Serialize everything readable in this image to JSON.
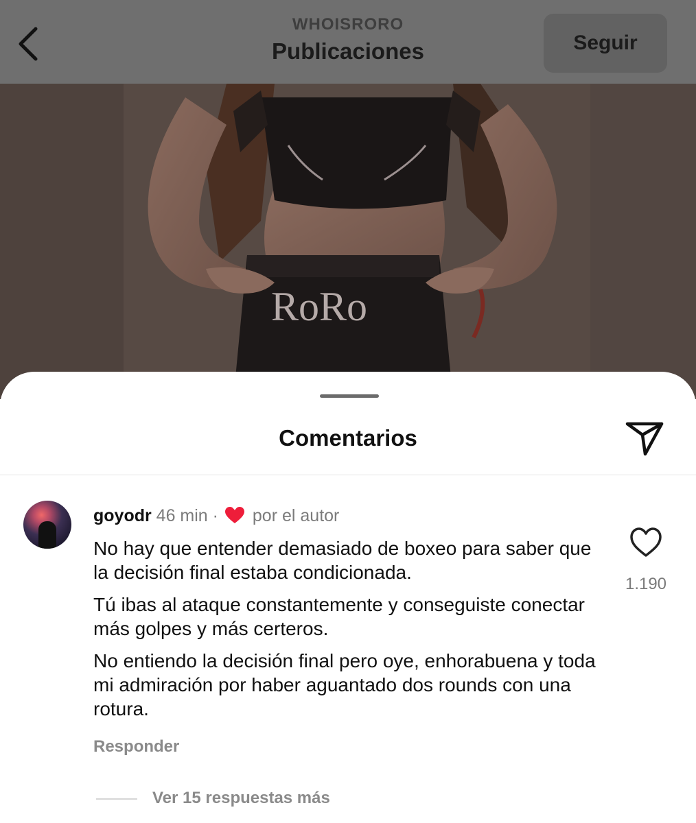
{
  "header": {
    "subtitle": "WHOISRORO",
    "title": "Publicaciones",
    "follow_label": "Seguir",
    "back_icon": "chevron-left-icon"
  },
  "post": {
    "shorts_text": "RoRo"
  },
  "comments_sheet": {
    "title": "Comentarios",
    "share_icon": "paper-plane-icon",
    "comment": {
      "username": "goyodr",
      "time": "46 min",
      "separator": "·",
      "liked_by_author_label": "por el autor",
      "paragraphs": [
        "No hay que entender demasiado de boxeo para saber que la decisión final estaba condicionada.",
        "Tú ibas al ataque constantemente y conseguiste conectar más golpes y más certeros.",
        "No entiendo la decisión final pero oye, enhorabuena y toda mi admiración por haber aguantado dos rounds con una rotura."
      ],
      "like_count": "1.190",
      "reply_label": "Responder",
      "view_replies_label": "Ver 15 respuestas más"
    }
  },
  "colors": {
    "heart_red": "#ee1d3a",
    "secondary_text": "#7b7b7b"
  }
}
